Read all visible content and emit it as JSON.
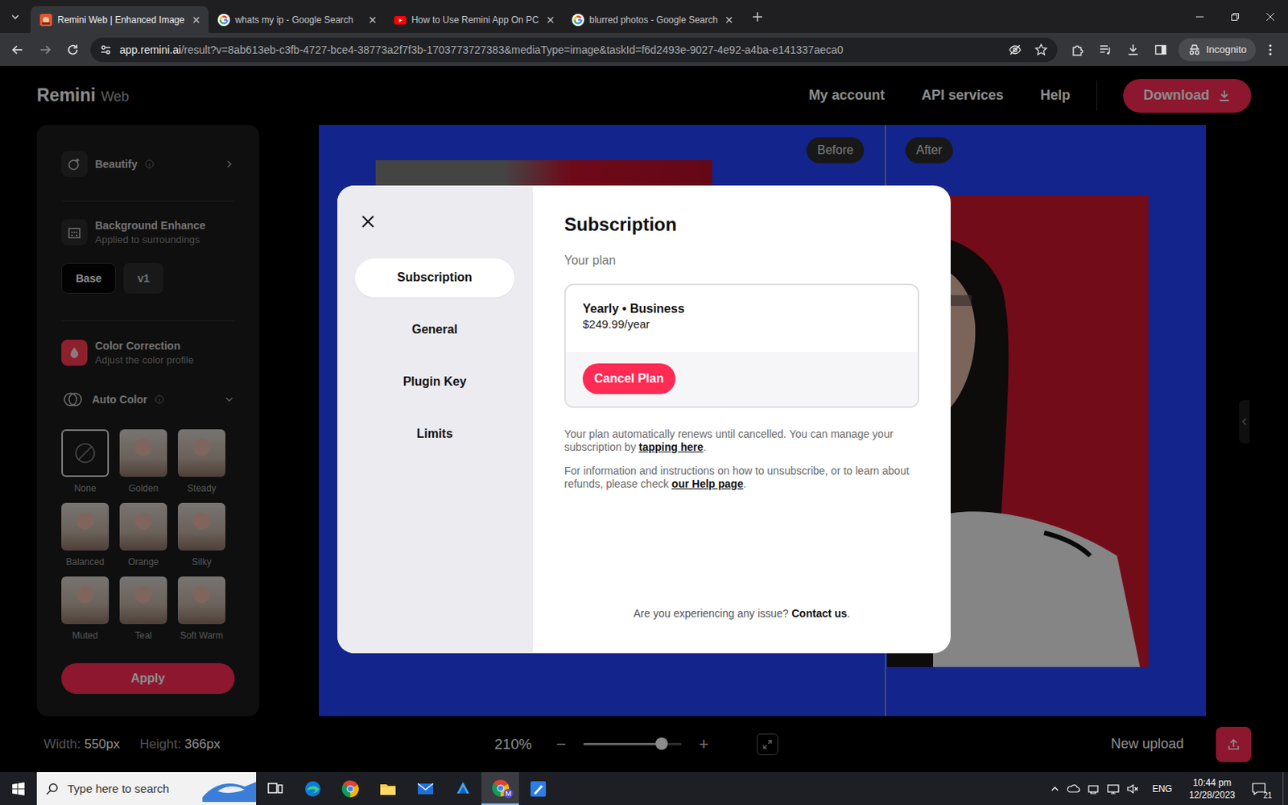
{
  "browser": {
    "tabs": [
      {
        "label": "Remini Web | Enhanced Image",
        "selected": true,
        "kind": "remini"
      },
      {
        "label": "whats my ip - Google Search",
        "selected": false,
        "kind": "google"
      },
      {
        "label": "How to Use Remini App On PC",
        "selected": false,
        "kind": "youtube"
      },
      {
        "label": "blurred photos - Google Search",
        "selected": false,
        "kind": "google"
      }
    ],
    "url_host": "app.remini.ai",
    "url_path": "/result?v=8ab613eb-c3fb-4727-bce4-38773a2f7f3b-1703773727383&mediaType=image&taskId=f6d2493e-9027-4e92-a4ba-e141337aeca0",
    "profile": "Incognito"
  },
  "header": {
    "logo": "Remini",
    "logo_sub": "Web",
    "nav": [
      "My account",
      "API services",
      "Help"
    ],
    "download": "Download"
  },
  "sidebar": {
    "beautify": "Beautify",
    "background_enhance": {
      "title": "Background Enhance",
      "subtitle": "Applied to surroundings",
      "versions": [
        {
          "label": "Base",
          "selected": true
        },
        {
          "label": "v1",
          "selected": false
        }
      ]
    },
    "color_correction": {
      "title": "Color Correction",
      "subtitle": "Adjust the color profile"
    },
    "auto_color": {
      "label": "Auto Color",
      "expanded": true
    },
    "filters": [
      {
        "label": "None",
        "selected": true,
        "kind": "none"
      },
      {
        "label": "Golden",
        "selected": false,
        "kind": "photo"
      },
      {
        "label": "Steady",
        "selected": false,
        "kind": "photo"
      },
      {
        "label": "Balanced",
        "selected": false,
        "kind": "photo"
      },
      {
        "label": "Orange",
        "selected": false,
        "kind": "photo"
      },
      {
        "label": "Silky",
        "selected": false,
        "kind": "photo"
      },
      {
        "label": "Muted",
        "selected": false,
        "kind": "photo"
      },
      {
        "label": "Teal",
        "selected": false,
        "kind": "photo"
      },
      {
        "label": "Soft Warm",
        "selected": false,
        "kind": "photo"
      }
    ],
    "apply": "Apply"
  },
  "canvas": {
    "before": "Before",
    "after": "After"
  },
  "footer": {
    "dimensions": [
      {
        "label": "Width:",
        "value": "550px"
      },
      {
        "label": "Height:",
        "value": "366px"
      }
    ],
    "zoom": {
      "reading": "210%",
      "level": 0.8,
      "minus": "−",
      "plus": "+"
    },
    "new_upload": "New upload"
  },
  "modal": {
    "nav": [
      {
        "label": "Subscription",
        "selected": true
      },
      {
        "label": "General",
        "selected": false
      },
      {
        "label": "Plugin Key",
        "selected": false
      },
      {
        "label": "Limits",
        "selected": false
      }
    ],
    "title": "Subscription",
    "plan_label": "Your plan",
    "plan": {
      "name": "Yearly • Business",
      "price": "$249.99/year",
      "cancel": "Cancel Plan"
    },
    "notes": [
      {
        "text": "Your plan automatically renews until cancelled. You can manage your subscription by ",
        "link": "tapping here",
        "after": "."
      },
      {
        "text": "For information and instructions on how to unsubscribe, or to learn about refunds, please check ",
        "link": "our Help page",
        "after": "."
      }
    ],
    "help": {
      "text": "Are you experiencing any issue? ",
      "link": "Contact us",
      "after": "."
    }
  },
  "taskbar": {
    "search": "Type here to search",
    "apps": [
      {
        "kind": "taskview",
        "active": false
      },
      {
        "kind": "edge",
        "active": false
      },
      {
        "kind": "chrome",
        "active": false
      },
      {
        "kind": "explorer",
        "active": false
      },
      {
        "kind": "mail",
        "active": false
      },
      {
        "kind": "bluestacks",
        "active": false
      },
      {
        "kind": "chrome",
        "active": true,
        "badge": "M"
      },
      {
        "kind": "editor",
        "active": false
      }
    ],
    "language": "ENG",
    "time": "10:44 pm",
    "date": "12/28/2023",
    "notifications": "21"
  }
}
